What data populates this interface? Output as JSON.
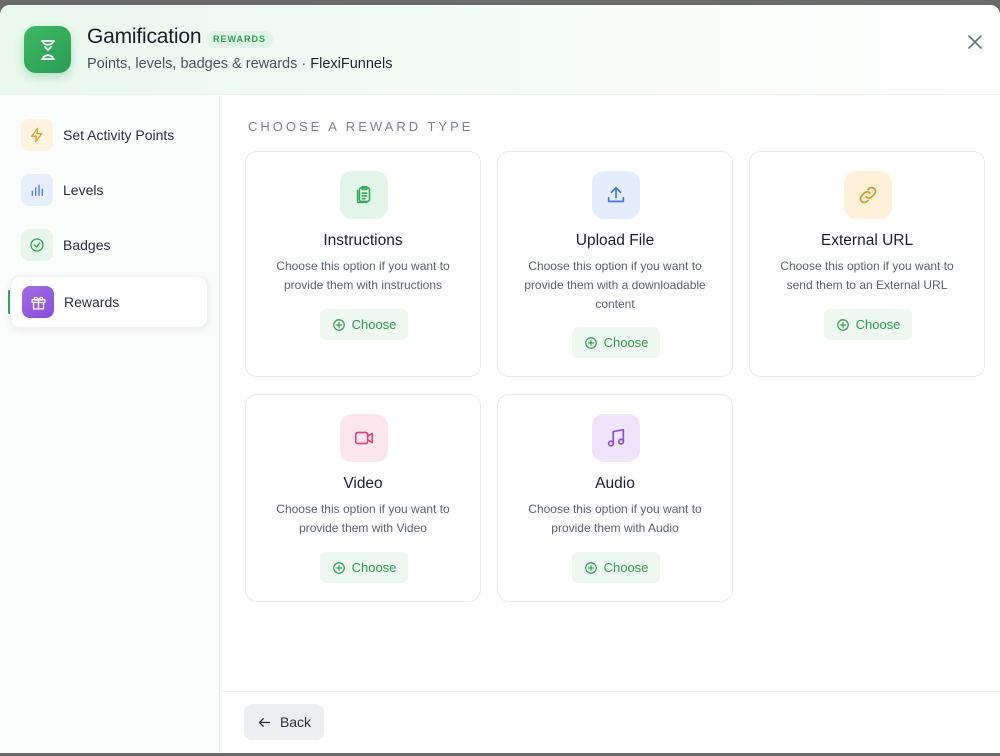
{
  "header": {
    "title": "Gamification",
    "badge": "REWARDS",
    "subtitle_prefix": "Points, levels, badges & rewards · ",
    "subtitle_brand": "FlexiFunnels",
    "app_icon": "trophy-icon",
    "close_icon": "close-icon"
  },
  "sidebar": {
    "items": [
      {
        "label": "Set Activity Points",
        "icon": "lightning-icon",
        "active": false
      },
      {
        "label": "Levels",
        "icon": "bar-chart-icon",
        "active": false
      },
      {
        "label": "Badges",
        "icon": "check-circle-icon",
        "active": false
      },
      {
        "label": "Rewards",
        "icon": "gift-icon",
        "active": true
      }
    ]
  },
  "main": {
    "section_title": "CHOOSE A REWARD TYPE",
    "cards": [
      {
        "title": "Instructions",
        "description": "Choose this option if you want to provide them with instructions",
        "button": "Choose",
        "icon": "clipboard-icon"
      },
      {
        "title": "Upload File",
        "description": "Choose this option if you want to provide them with a downloadable content",
        "button": "Choose",
        "icon": "upload-icon"
      },
      {
        "title": "External URL",
        "description": "Choose this option if you want to send them to an External URL",
        "button": "Choose",
        "icon": "link-icon"
      },
      {
        "title": "Video",
        "description": "Choose this option if you want to provide them with Video",
        "button": "Choose",
        "icon": "video-icon"
      },
      {
        "title": "Audio",
        "description": "Choose this option if you want to provide them with Audio",
        "button": "Choose",
        "icon": "music-icon"
      }
    ]
  },
  "footer": {
    "back_label": "Back",
    "back_icon": "arrow-left-icon"
  },
  "colors": {
    "accent": "#34a85a",
    "accent_light": "#eef8f1"
  }
}
